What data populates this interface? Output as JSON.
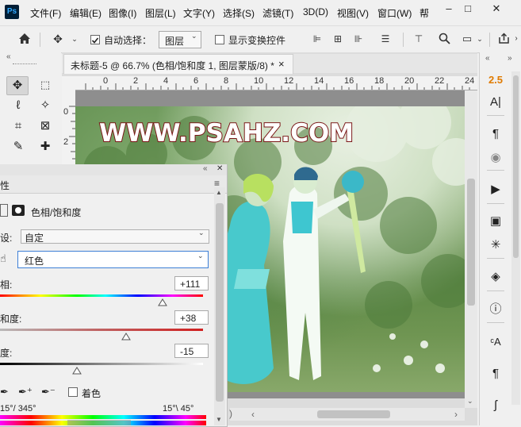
{
  "app": {
    "logo": "Ps"
  },
  "menu": {
    "items": [
      "文件(F)",
      "编辑(E)",
      "图像(I)",
      "图层(L)",
      "文字(Y)",
      "选择(S)",
      "滤镜(T)",
      "3D(D)",
      "视图(V)",
      "窗口(W)",
      "帮"
    ]
  },
  "window_controls": {
    "minimize": "–",
    "maximize": "□",
    "close": "✕"
  },
  "options": {
    "auto_select_label": "自动选择：",
    "auto_select_target": "图层",
    "show_transform_label": "显示变换控件"
  },
  "document": {
    "tab_title": "未标题-5 @ 66.7% (色相/饱和度 1, 图层蒙版/8) *",
    "close": "×",
    "h_ruler_ticks": [
      "0",
      "2",
      "4",
      "6",
      "8",
      "10",
      "12",
      "14",
      "16",
      "18",
      "20",
      "22",
      "24"
    ],
    "v_ruler_ticks": [
      "0",
      "2"
    ],
    "watermark": "WWW.PSAHZ.COM"
  },
  "right_dock": {
    "version_number": "2.5"
  },
  "properties": {
    "title_fragment": "性",
    "adjustment_name": "色相/饱和度",
    "preset_label": "设:",
    "preset_value": "自定",
    "channel_value": "红色",
    "hue_label": "相:",
    "hue_value": "+111",
    "saturation_label": "和度:",
    "saturation_value": "+38",
    "lightness_label": "度:",
    "lightness_value": "-15",
    "colorize_label": "着色",
    "range_left": "15°/ 345°",
    "range_right": "15°\\ 45°",
    "hue_level": 0.8,
    "saturation_level": 0.62,
    "lightness_level": 0.38
  },
  "colors": {
    "accent_number": "#e07b00",
    "watermark_stroke": "#7a1616"
  }
}
